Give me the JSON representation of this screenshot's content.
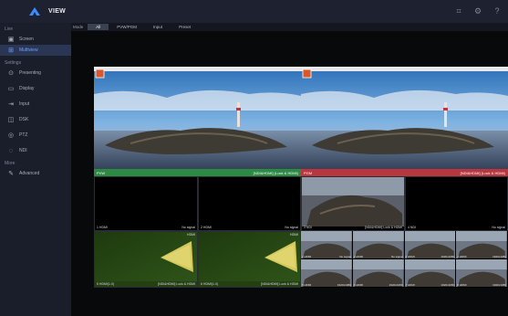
{
  "app": {
    "title": "VIEW"
  },
  "window": {
    "icons": [
      "grid-icon",
      "gear-icon",
      "help-icon"
    ]
  },
  "sidebar": {
    "sections": [
      {
        "label": "Live",
        "items": [
          {
            "label": "Screen",
            "icon": "screen-icon",
            "active": false
          },
          {
            "label": "Multiview",
            "icon": "multiview-icon",
            "active": true
          }
        ]
      },
      {
        "label": "Settings",
        "items": [
          {
            "label": "Presenting",
            "icon": "presenting-icon",
            "active": false
          },
          {
            "label": "Display",
            "icon": "display-icon",
            "active": false
          },
          {
            "label": "Input",
            "icon": "input-icon",
            "active": false
          },
          {
            "label": "DSK",
            "icon": "dsk-icon",
            "active": false
          },
          {
            "label": "PTZ",
            "icon": "ptz-icon",
            "active": false
          },
          {
            "label": "NDI",
            "icon": "ndi-icon",
            "active": false
          }
        ]
      },
      {
        "label": "More",
        "items": [
          {
            "label": "Advanced",
            "icon": "advanced-icon",
            "active": false
          }
        ]
      }
    ]
  },
  "modebar": {
    "label": "Mode",
    "tabs": [
      {
        "label": "All",
        "active": true
      },
      {
        "label": "PVW/PGM",
        "active": false
      },
      {
        "label": "Input",
        "active": false
      },
      {
        "label": "Preset",
        "active": false
      }
    ]
  },
  "multiview": {
    "preview": {
      "label": "PVW",
      "source": "[NDI&HDMI] (Lock & HDMI)",
      "color": "#2c8a43"
    },
    "program": {
      "label": "PGM",
      "source": "[NDI&HDMI] (Lock & HDMI)",
      "color": "#b8363e"
    },
    "row1": [
      {
        "id": "1 HDMI",
        "status": "No signal",
        "sub": ""
      },
      {
        "id": "2 HDMI",
        "status": "No signal",
        "sub": "HDMI"
      },
      {
        "id": "3 NDI",
        "status": "[NDI&HDMI] Lock & HDMI",
        "sub": ""
      },
      {
        "id": "4 NDI",
        "status": "No signal",
        "sub": ""
      }
    ],
    "row2": [
      {
        "id": "5 HDMI(1.0)",
        "status": "[NDI&HDMI] Lock & HDMI",
        "sub": "HDMI"
      },
      {
        "id": "6 HDMI(1.0)",
        "status": "[NDI&HDMI] Lock & HDMI",
        "sub": "HDMI"
      }
    ],
    "minis": [
      {
        "id": "1 HDMI",
        "status": "No signal"
      },
      {
        "id": "2 HDMI",
        "status": "No signal"
      },
      {
        "id": "3 HDMI",
        "status": "1920x1080"
      },
      {
        "id": "4 HDMI",
        "status": "1920x1080"
      },
      {
        "id": "5 HDMI",
        "status": "1920x1080"
      },
      {
        "id": "6 HDMI",
        "status": "1920x1080"
      },
      {
        "id": "7 HDMI",
        "status": "1920x1080"
      },
      {
        "id": "8 HDMI",
        "status": "1920x1080"
      }
    ]
  }
}
